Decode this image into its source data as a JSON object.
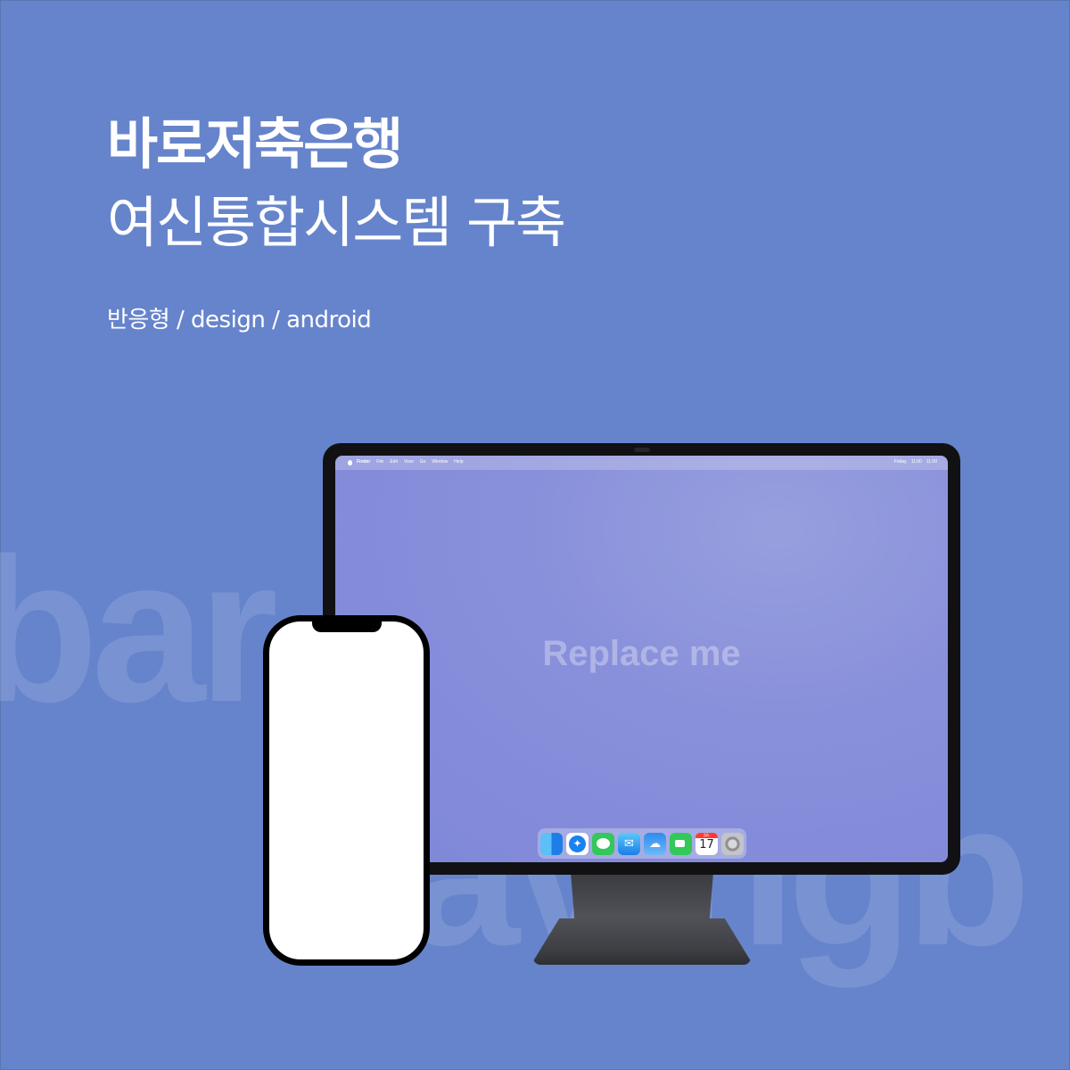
{
  "headline": {
    "line1": "바로저축은행",
    "line2": "여신통합시스템 구축"
  },
  "tags": "반응형 / design / android",
  "background_words": [
    "bar",
    "avingb"
  ],
  "colors": {
    "background": "#6684cc",
    "screen": "#8990db",
    "text": "#ffffff"
  },
  "monitor": {
    "menubar": {
      "app": "Finder",
      "items": [
        "File",
        "Edit",
        "View",
        "Go",
        "Window",
        "Help"
      ],
      "clock": [
        "Friday",
        "11:00",
        "11:00"
      ]
    },
    "placeholder": "Replace me",
    "dock": {
      "icons": [
        "finder-icon",
        "safari-icon",
        "messages-icon",
        "mail-icon",
        "weather-icon",
        "facetime-icon",
        "calendar-icon",
        "settings-icon"
      ],
      "calendar_month": "JUL",
      "calendar_day": "17"
    }
  }
}
